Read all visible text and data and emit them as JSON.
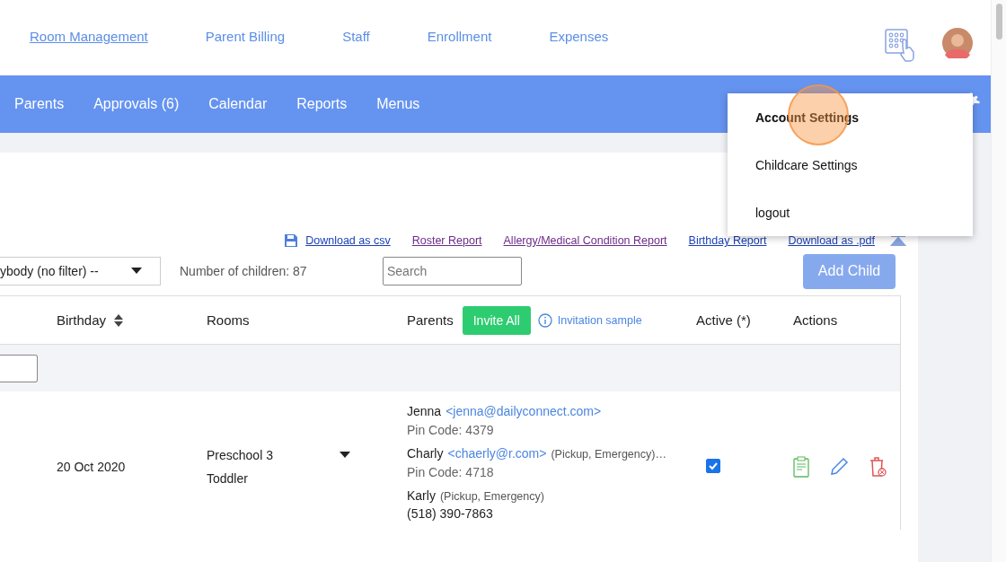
{
  "top_nav": [
    {
      "label": "Room Management",
      "selected": true
    },
    {
      "label": "Parent Billing",
      "selected": false
    },
    {
      "label": "Staff",
      "selected": false
    },
    {
      "label": "Enrollment",
      "selected": false
    },
    {
      "label": "Expenses",
      "selected": false
    }
  ],
  "main_nav": [
    "Parents",
    "Approvals (6)",
    "Calendar",
    "Reports",
    "Menus"
  ],
  "account_menu": [
    {
      "label": "Account Settings",
      "selected": true
    },
    {
      "label": "Childcare Settings",
      "selected": false
    },
    {
      "label": "logout",
      "selected": false
    }
  ],
  "report_links": [
    {
      "label": "Download as csv",
      "kind": "csv",
      "visited": false
    },
    {
      "label": "Roster Report",
      "kind": "link",
      "visited": true
    },
    {
      "label": "Allergy/Medical Condition Report",
      "kind": "link",
      "visited": true
    },
    {
      "label": "Birthday Report",
      "kind": "link",
      "visited": false
    },
    {
      "label": "Download as .pdf",
      "kind": "link",
      "visited": false
    }
  ],
  "filter": {
    "value": "ybody (no filter) --"
  },
  "children_count": "Number of children: 87",
  "search": {
    "placeholder": "Search"
  },
  "add_button": "Add Child",
  "columns": [
    {
      "label": "Birthday",
      "sortable": true
    },
    {
      "label": "Rooms",
      "sortable": false
    },
    {
      "label": "Parents",
      "sortable": false
    },
    {
      "label": "Active (*)",
      "sortable": false
    },
    {
      "label": "Actions",
      "sortable": false
    }
  ],
  "invite_button": "Invite All",
  "invitation_link": "Invitation sample",
  "row": {
    "birthday": "20 Oct 2020",
    "rooms": [
      "Preschool 3",
      "Toddler"
    ],
    "active": true,
    "parents": [
      {
        "name": "Jenna",
        "email": "<jenna@dailyconnect.com>",
        "pin": "Pin Code: 4379"
      },
      {
        "name": "Charly",
        "email": "<chaerly@r.com>",
        "roles": "(Pickup, Emergency)…",
        "pin": "Pin Code: 4718"
      },
      {
        "name": "Karly",
        "roles": "(Pickup, Emergency)",
        "phone": "(518) 390-7863"
      }
    ]
  }
}
